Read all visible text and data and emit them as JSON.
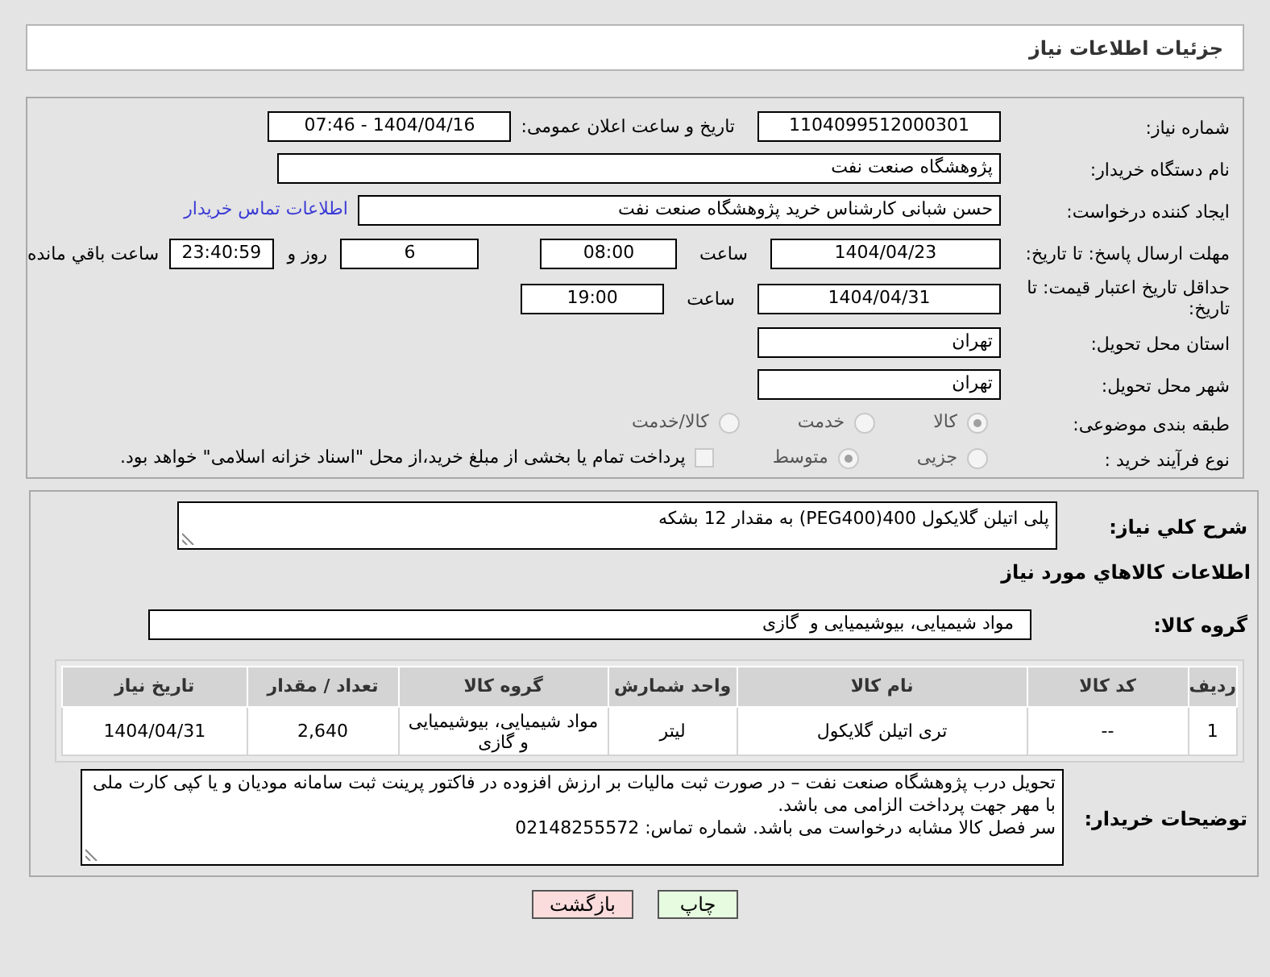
{
  "header": {
    "title": "جزئیات اطلاعات نیاز"
  },
  "need_number": {
    "label": "شماره نیاز:",
    "value": "1104099512000301"
  },
  "announcement": {
    "label": "تاریخ و ساعت اعلان عمومی:",
    "value": "1404/04/16 - 07:46"
  },
  "buyer_org": {
    "label": "نام دستگاه خریدار:",
    "value": "پژوهشگاه صنعت نفت"
  },
  "requester": {
    "label": "ایجاد کننده درخواست:",
    "value": "حسن شبانی کارشناس خرید پژوهشگاه صنعت نفت",
    "link": "اطلاعات تماس خریدار"
  },
  "reply_deadline": {
    "label": "مهلت ارسال پاسخ: تا تاریخ:",
    "date": "1404/04/23",
    "time_label": "ساعت",
    "time": "08:00",
    "days": "6",
    "days_label": "روز و",
    "remaining": "23:40:59",
    "remaining_label": "ساعت باقي مانده"
  },
  "price_validity": {
    "label": "حداقل تاریخ اعتبار قیمت: تا تاریخ:",
    "date": "1404/04/31",
    "time_label": "ساعت",
    "time": "19:00"
  },
  "province": {
    "label": "استان محل تحویل:",
    "value": "تهران"
  },
  "city": {
    "label": "شهر محل تحویل:",
    "value": "تهران"
  },
  "category": {
    "label": "طبقه بندی موضوعی:",
    "options": [
      {
        "label": "کالا",
        "selected": true
      },
      {
        "label": "خدمت",
        "selected": false
      },
      {
        "label": "کالا/خدمت",
        "selected": false
      }
    ]
  },
  "process": {
    "label": "نوع فرآیند خرید :",
    "options": [
      {
        "label": "جزیی",
        "selected": false
      },
      {
        "label": "متوسط",
        "selected": true
      }
    ],
    "payment": {
      "checked": false,
      "text": "پرداخت تمام یا بخشی از مبلغ خرید،از محل \"اسناد خزانه اسلامی\" خواهد بود."
    }
  },
  "description": {
    "label": "شرح کلي نياز:",
    "value": "پلی اتیلن گلایکول 400(PEG400) به مقدار 12 بشکه"
  },
  "goods_heading": "اطلاعات كالاهاي مورد نياز",
  "goods_group": {
    "label": "گروه کالا:",
    "value": "مواد شیمیایی، بیوشیمیایی و  گازی"
  },
  "table": {
    "columns": [
      "ردیف",
      "کد کالا",
      "نام کالا",
      "واحد شمارش",
      "گروه کالا",
      "تعداد / مقدار",
      "تاریخ نیاز"
    ],
    "rows": [
      [
        "1",
        "--",
        "تری اتیلن گلایکول",
        "لیتر",
        "مواد شیمیایی، بیوشیمیایی و گازی",
        "2,640",
        "1404/04/31"
      ]
    ]
  },
  "buyer_notes": {
    "label": "توضیحات خریدار:",
    "lines": [
      "تحویل درب پژوهشگاه صنعت نفت – در صورت ثبت مالیات بر ارزش افزوده در فاکتور پرینت ثبت سامانه مودیان و یا کپی کارت ملی با مهر جهت پرداخت الزامی می باشد.",
      "سر فصل کالا مشابه درخواست می باشد. شماره تماس: 02148255572"
    ]
  },
  "buttons": [
    {
      "kind": "print",
      "label": "چاپ"
    },
    {
      "kind": "back",
      "label": "بازگشت"
    }
  ]
}
